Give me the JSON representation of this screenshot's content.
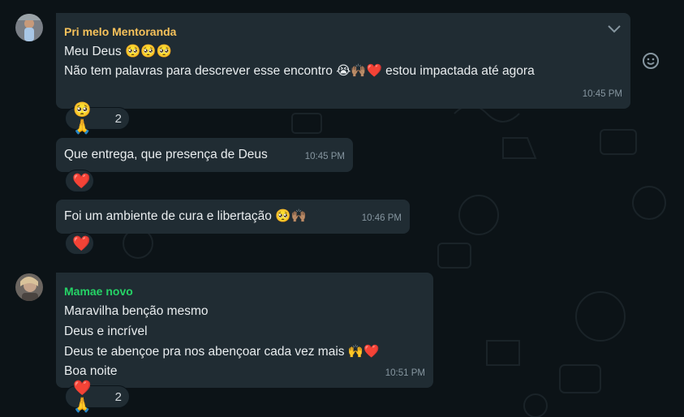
{
  "messages": [
    {
      "sender": "Pri melo Mentoranda",
      "sender_color": "#f7c25b",
      "lines": [
        "Meu Deus 🥺🥺🥺",
        "Não tem palavras para descrever esse encontro 😭🙌🏽❤️ estou impactada até agora"
      ],
      "time": "10:45 PM",
      "reactions": {
        "emojis": "🥺🙏",
        "count": "2"
      }
    },
    {
      "text": "Que entrega, que presença de Deus",
      "time": "10:45 PM",
      "reactions": {
        "emojis": "❤️"
      }
    },
    {
      "text": "Foi um ambiente de cura e libertação 🥺🙌🏽",
      "time": "10:46 PM",
      "reactions": {
        "emojis": "❤️"
      }
    },
    {
      "sender": "Mamae novo",
      "sender_color": "#25d366",
      "lines": [
        "Maravilha benção mesmo",
        "Deus e incrível",
        "Deus te abençoe pra nos abençoar cada vez mais 🙌❤️",
        "Boa noite"
      ],
      "time": "10:51 PM",
      "reactions": {
        "emojis": "❤️🙏",
        "count": "2"
      }
    }
  ],
  "icons": {
    "menu": "chevron-down-icon",
    "react": "smiley-icon"
  }
}
